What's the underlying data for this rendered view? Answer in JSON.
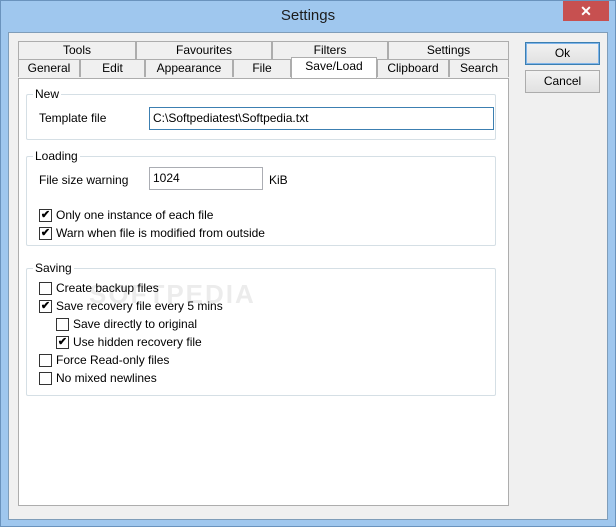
{
  "window": {
    "title": "Settings",
    "close_glyph": "✕"
  },
  "tabs_back": [
    "Tools",
    "Favourites",
    "Filters",
    "Settings"
  ],
  "tabs_front": [
    "General",
    "Edit",
    "Appearance",
    "File",
    "Save/Load",
    "Clipboard",
    "Search"
  ],
  "active_tab": "Save/Load",
  "new_group": {
    "title": "New",
    "template_label": "Template file",
    "template_value": "C:\\Softpediatest\\Softpedia.txt"
  },
  "loading_group": {
    "title": "Loading",
    "filesize_label": "File size warning",
    "filesize_value": "1024",
    "filesize_unit": "KiB",
    "checks": [
      {
        "label": "Only one instance of each file",
        "checked": true
      },
      {
        "label": "Warn when file is modified from outside",
        "checked": true
      }
    ]
  },
  "saving_group": {
    "title": "Saving",
    "checks": [
      {
        "label": "Create backup files",
        "checked": false
      },
      {
        "label": "Save recovery file every 5 mins",
        "checked": true
      },
      {
        "label": "Save directly to original",
        "checked": false
      },
      {
        "label": "Use hidden recovery file",
        "checked": true
      },
      {
        "label": "Force Read-only files",
        "checked": false
      },
      {
        "label": "No mixed newlines",
        "checked": false
      }
    ]
  },
  "buttons": {
    "ok": "Ok",
    "cancel": "Cancel"
  },
  "watermark": "SOFTPEDIA",
  "check_glyph": "✔"
}
